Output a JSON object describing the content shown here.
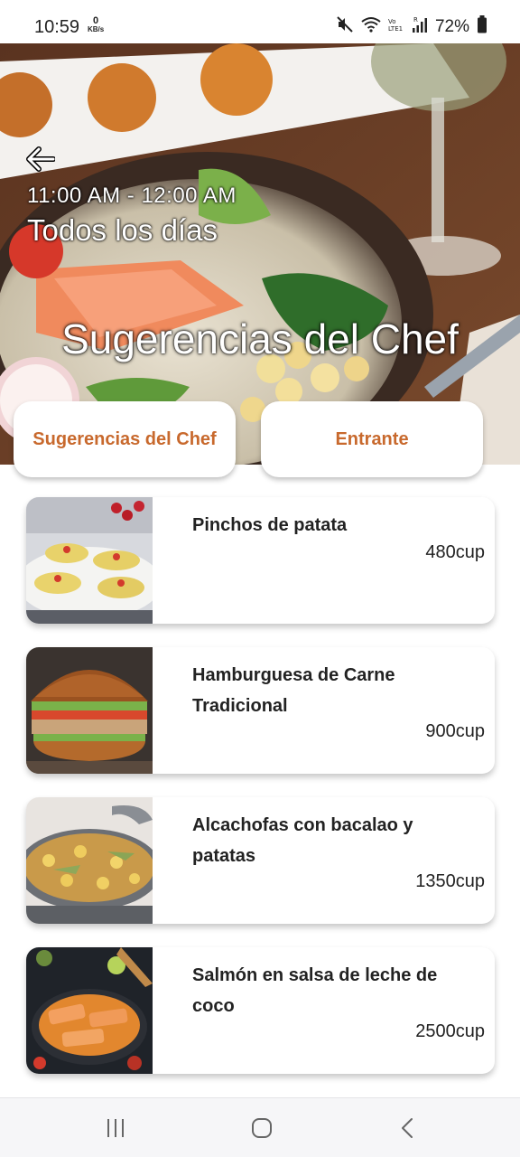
{
  "status_bar": {
    "time": "10:59",
    "net_speed_value": "0",
    "net_speed_unit": "KB/s",
    "battery": "72%",
    "icons": [
      "mute-icon",
      "wifi-icon",
      "volte-icon",
      "signal-icon",
      "battery-icon"
    ]
  },
  "hero": {
    "schedule": "11:00 AM - 12:00 AM",
    "days": "Todos los días",
    "title": "Sugerencias del Chef",
    "back_icon": "arrow-back-icon"
  },
  "tabs": [
    {
      "label": "Sugerencias del Chef"
    },
    {
      "label": "Entrante"
    }
  ],
  "items": [
    {
      "name": "Pinchos de patata",
      "price": "480cup",
      "image": "potato-skewers"
    },
    {
      "name": "Hamburguesa de Carne Tradicional",
      "price": "900cup",
      "image": "burger"
    },
    {
      "name": "Alcachofas con bacalao y patatas",
      "price": "1350cup",
      "image": "artichoke-stew"
    },
    {
      "name": "Salmón en salsa de leche de coco",
      "price": "2500cup",
      "image": "salmon-pan"
    }
  ],
  "colors": {
    "accent": "#c8692d",
    "text": "#222222",
    "nav_bg": "#f6f6f8"
  },
  "nav_bar": {
    "icons": [
      "recent-apps-icon",
      "home-icon",
      "back-nav-icon"
    ]
  }
}
